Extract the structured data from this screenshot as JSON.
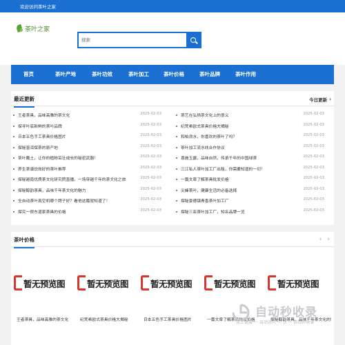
{
  "topbar": {
    "welcome": "欢迎访问茶叶之家"
  },
  "logo": {
    "text": "茶叶之家"
  },
  "search": {
    "placeholder": "搜索"
  },
  "nav": [
    "首页",
    "茶叶产地",
    "茶叶功效",
    "茶叶加工",
    "茶叶价格",
    "茶叶品牌",
    "茶叶作用"
  ],
  "latest": {
    "title": "最近更新",
    "more": "今日更新",
    "left": [
      {
        "title": "王者茶具，品味高雅的茶文化",
        "date": "2025-02-03"
      },
      {
        "title": "探寻叶底新鲜的茶叶品牌",
        "date": "2025-02-03"
      },
      {
        "title": "日本五色手工茶具价格图片",
        "date": "2025-02-03"
      },
      {
        "title": "探秘普洱保茶的原产地",
        "date": "2025-02-03"
      },
      {
        "title": "茶叶戴土，让你的植物茁壮成长的秘密武器！",
        "date": "2025-02-03"
      },
      {
        "title": "养生茶谱饮效好的茶叶推荐",
        "date": "2025-02-03"
      },
      {
        "title": "探秘越南优质茶文化研究院直播，一场穿越千年的茶文化之旅",
        "date": "2025-02-03"
      },
      {
        "title": "探秘醇韵茶具，品味千年茶文化的魅力",
        "date": "2025-02-03"
      },
      {
        "title": "全自动茶叶真空机哪个牌子好？看他这篇就知道了！",
        "date": "2025-02-03"
      },
      {
        "title": "探究一很东道家茶具的价格",
        "date": "2025-02-03"
      }
    ],
    "right": [
      {
        "title": "茶艺在弘扬茶文化上的意义",
        "date": "2025-02-03"
      },
      {
        "title": "纪梵希欧式茶具价格大揭秘",
        "date": "2025-02-03"
      },
      {
        "title": "和柏浪水，你喜欢的茶叶了吗？",
        "date": "2025-02-03"
      },
      {
        "title": "茶叶加工流水线合作协议",
        "date": "2025-02-03"
      },
      {
        "title": "恩施玉露，品味自然，传承千年的中国绿茶",
        "date": "2025-02-03"
      },
      {
        "title": "三江私人茶叶加工厂出租，你需要知道的一切！",
        "date": "2025-02-03"
      },
      {
        "title": "一篇文章了解茶具批发价格",
        "date": "2025-02-03"
      },
      {
        "title": "尖峰茶叶，健康生活的必备选择",
        "date": "2025-02-03"
      },
      {
        "title": "探秘景德镇青香茶叶加工厂",
        "date": "2025-02-03"
      },
      {
        "title": "探秘三亚茶叶加工厂，知名品牌一览",
        "date": "2025-02-03"
      }
    ]
  },
  "price": {
    "title": "茶叶价格",
    "no_image_text": "暂无预览图",
    "cards": [
      "王者茶具，品味高雅的茶文化",
      "纪梵希欧式茶具价格大揭秘",
      "日本五色手工茶具价格图片",
      "一篇文章了解茶具批发价格",
      "探秘醇韵茶具，品味千年茶文化的魅力"
    ]
  },
  "watermark": {
    "title": "自动秒收录",
    "subtitle": "放上链接 一 自动访问 一 次 一 自动秒收录"
  },
  "colors": {
    "primary": "#1a6fd0",
    "accent_red": "#d9352b"
  }
}
